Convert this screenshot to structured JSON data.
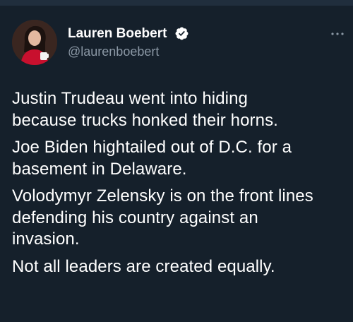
{
  "tweet": {
    "author": {
      "name": "Lauren Boebert",
      "handle": "@laurenboebert",
      "verified": true
    },
    "paragraphs": [
      [
        "Justin Trudeau went into hiding",
        "because trucks honked their horns."
      ],
      [
        "Joe Biden hightailed out of D.C. for a",
        "basement in Delaware."
      ],
      [
        "Volodymyr Zelensky is on the front lines",
        "defending his country against an",
        "invasion."
      ],
      [
        "Not all leaders are created equally."
      ]
    ]
  },
  "colors": {
    "background": "#15202b",
    "text": "#ffffff",
    "secondary_text": "#8b98a5",
    "verified_badge": "#ffffff"
  },
  "icons": {
    "verified": "verified-badge-icon",
    "more": "more-options-icon"
  }
}
